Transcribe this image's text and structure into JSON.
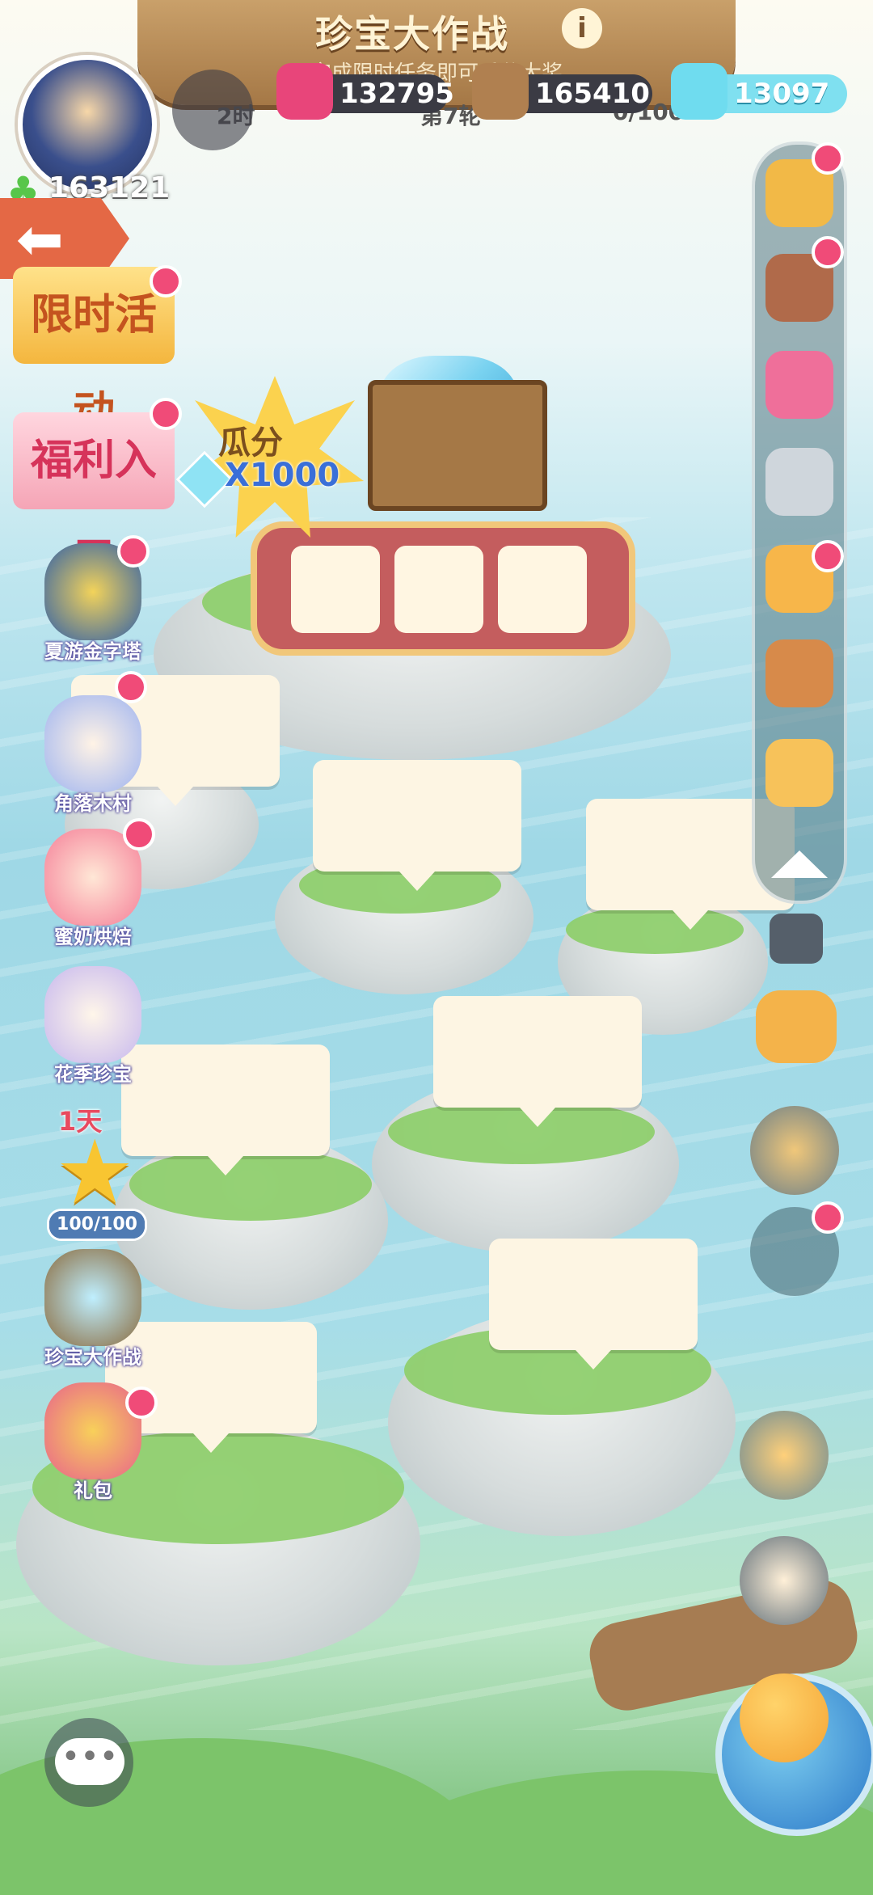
{
  "header": {
    "title": "珍宝大作战",
    "subtitle": "完成限时任务即可瓜分大奖",
    "info_icon": "info-icon",
    "status_left": "2时",
    "status_round": "第7轮",
    "status_count": "0/100"
  },
  "currencies": [
    {
      "name": "potion",
      "value": "132795",
      "color": "#e8457a"
    },
    {
      "name": "wood",
      "value": "165410",
      "color": "#b08050"
    },
    {
      "name": "gem",
      "value": "13097",
      "color": "#6fdcef"
    }
  ],
  "player": {
    "coins": "163121"
  },
  "left_menu": {
    "back_icon": "back-arrow-icon",
    "limited_event": "限时活动",
    "welfare": "福利入口",
    "items": [
      {
        "label": "夏游金字塔"
      },
      {
        "label": "角落木村"
      },
      {
        "label": "蜜奶烘焙"
      },
      {
        "label": "花季珍宝"
      },
      {
        "label": "珍宝大作战"
      },
      {
        "label": "礼包"
      }
    ],
    "star_days": "1天",
    "star_progress_text": "100/100",
    "star_progress": 1.0
  },
  "prize": {
    "share_label": "瓜分",
    "share_amount": "X1000"
  },
  "colors": {
    "accent_red": "#f04b78",
    "board_brown": "#a57846"
  }
}
